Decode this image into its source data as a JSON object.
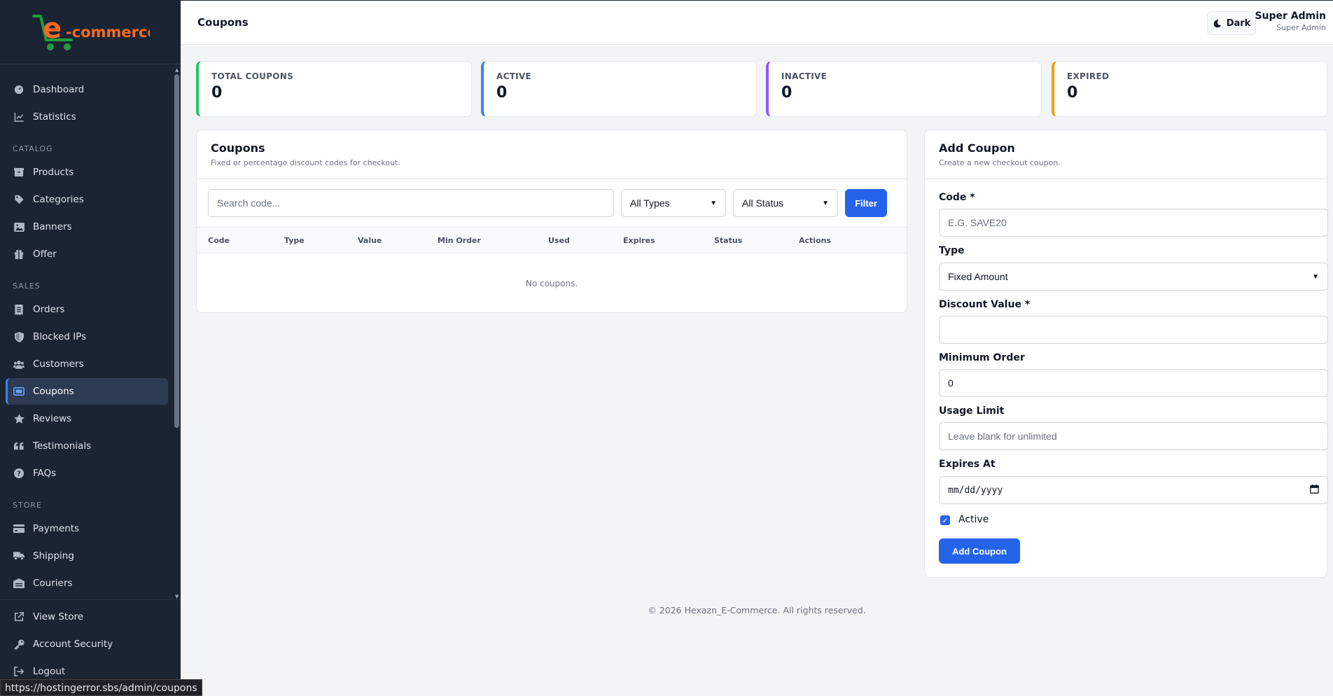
{
  "brand": {
    "logo_letter": "e",
    "logo_text": "-commerce",
    "logo_color": "#f26b21",
    "cart_color": "#1f9d3a"
  },
  "sidebar": {
    "items_top": [
      {
        "label": "Dashboard"
      },
      {
        "label": "Statistics"
      }
    ],
    "section_catalog": "CATALOG",
    "items_catalog": [
      {
        "label": "Products"
      },
      {
        "label": "Categories"
      },
      {
        "label": "Banners"
      },
      {
        "label": "Offer"
      }
    ],
    "section_sales": "SALES",
    "items_sales": [
      {
        "label": "Orders"
      },
      {
        "label": "Blocked IPs"
      },
      {
        "label": "Customers"
      },
      {
        "label": "Coupons"
      },
      {
        "label": "Reviews"
      },
      {
        "label": "Testimonials"
      },
      {
        "label": "FAQs"
      }
    ],
    "section_store": "STORE",
    "items_store": [
      {
        "label": "Payments"
      },
      {
        "label": "Shipping"
      },
      {
        "label": "Couriers"
      }
    ],
    "items_bottom": [
      {
        "label": "View Store"
      },
      {
        "label": "Account Security"
      },
      {
        "label": "Logout"
      }
    ]
  },
  "status_url": "https://hostingerror.sbs/admin/coupons",
  "topbar": {
    "title": "Coupons",
    "theme_toggle": "Dark",
    "user_name": "Super Admin",
    "user_role": "Super Admin"
  },
  "stats": [
    {
      "label": "TOTAL COUPONS",
      "value": "0",
      "color": "#22c55e"
    },
    {
      "label": "ACTIVE",
      "value": "0",
      "color": "#3b82f6"
    },
    {
      "label": "INACTIVE",
      "value": "0",
      "color": "#8b5cf6"
    },
    {
      "label": "EXPIRED",
      "value": "0",
      "color": "#f59e0b"
    }
  ],
  "list": {
    "title": "Coupons",
    "subtitle": "Fixed or percentage discount codes for checkout.",
    "search_placeholder": "Search code...",
    "type_filter": "All Types",
    "status_filter": "All Status",
    "filter_button": "Filter",
    "columns": [
      "Code",
      "Type",
      "Value",
      "Min Order",
      "Used",
      "Expires",
      "Status",
      "Actions"
    ],
    "empty_text": "No coupons."
  },
  "form": {
    "title": "Add Coupon",
    "subtitle": "Create a new checkout coupon.",
    "code_label": "Code *",
    "code_placeholder": "E.G. SAVE20",
    "type_label": "Type",
    "type_value": "Fixed Amount",
    "discount_label": "Discount Value *",
    "discount_value": "",
    "min_order_label": "Minimum Order",
    "min_order_value": "0",
    "usage_label": "Usage Limit",
    "usage_placeholder": "Leave blank for unlimited",
    "expires_label": "Expires At",
    "expires_placeholder": "mm/dd/yyyy",
    "active_label": "Active",
    "active_checked": true,
    "submit_label": "Add Coupon"
  },
  "footer": "© 2026 Hexazn_E-Commerce. All rights reserved."
}
